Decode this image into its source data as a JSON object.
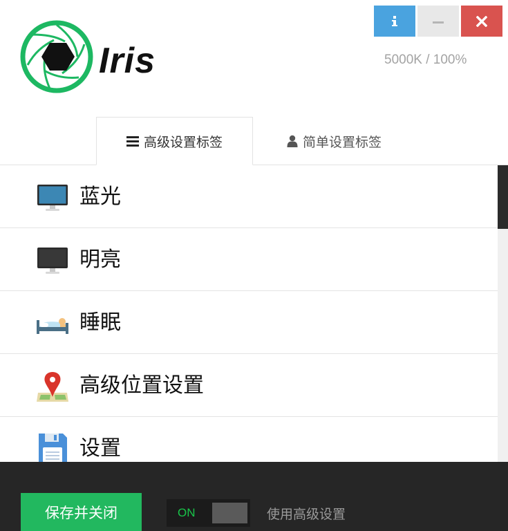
{
  "window": {
    "info_icon": "info-icon",
    "minimize_icon": "minimize-icon",
    "close_icon": "close-icon"
  },
  "app": {
    "name": "Iris",
    "status": "5000K / 100%"
  },
  "tabs": [
    {
      "label": "高级设置标签",
      "icon": "hamburger-icon",
      "active": true
    },
    {
      "label": "简单设置标签",
      "icon": "user-icon",
      "active": false
    }
  ],
  "menu": [
    {
      "label": "蓝光",
      "icon": "blue-monitor-icon"
    },
    {
      "label": "明亮",
      "icon": "dark-monitor-icon"
    },
    {
      "label": "睡眠",
      "icon": "bed-icon"
    },
    {
      "label": "高级位置设置",
      "icon": "location-pin-icon"
    },
    {
      "label": "设置",
      "icon": "floppy-disk-icon"
    }
  ],
  "footer": {
    "save_label": "保存并关闭",
    "toggle_state": "ON",
    "toggle_label": "使用高级设置"
  },
  "colors": {
    "brand_green": "#22b85f",
    "info_blue": "#4aa3df",
    "close_red": "#d9534f",
    "footer_bg": "#262626"
  }
}
